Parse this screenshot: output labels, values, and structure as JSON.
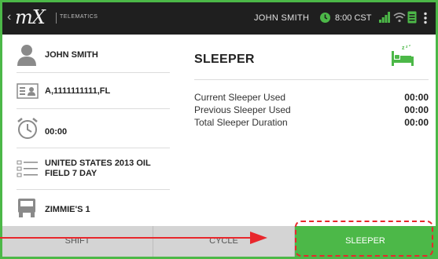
{
  "topbar": {
    "logo": "mX",
    "subbrand": "TELEMATICS",
    "driver_name": "JOHN SMITH",
    "time": "8:00 CST",
    "icons": [
      "clock-icon",
      "signal-icon",
      "wifi-icon",
      "document-icon",
      "overflow-menu-icon"
    ]
  },
  "left_panel": {
    "driver_name": "JOHN SMITH",
    "license": "A,1111111111,FL",
    "alarm_time": "00:00",
    "ruleset": "UNITED STATES 2013 OIL FIELD 7 DAY",
    "vehicle": "ZIMMIE'S 1"
  },
  "sleeper": {
    "title": "SLEEPER",
    "rows": [
      {
        "label": "Current Sleeper Used",
        "value": "00:00"
      },
      {
        "label": "Previous Sleeper Used",
        "value": "00:00"
      },
      {
        "label": "Total Sleeper Duration",
        "value": "00:00"
      }
    ]
  },
  "tabs": [
    {
      "label": "SHIFT",
      "active": false
    },
    {
      "label": "CYCLE",
      "active": false
    },
    {
      "label": "SLEEPER",
      "active": true
    }
  ],
  "colors": {
    "accent": "#4cb848",
    "topbar_bg": "#1f1f1f",
    "tab_inactive": "#d4d4d4",
    "annotation": "#e8272c"
  }
}
